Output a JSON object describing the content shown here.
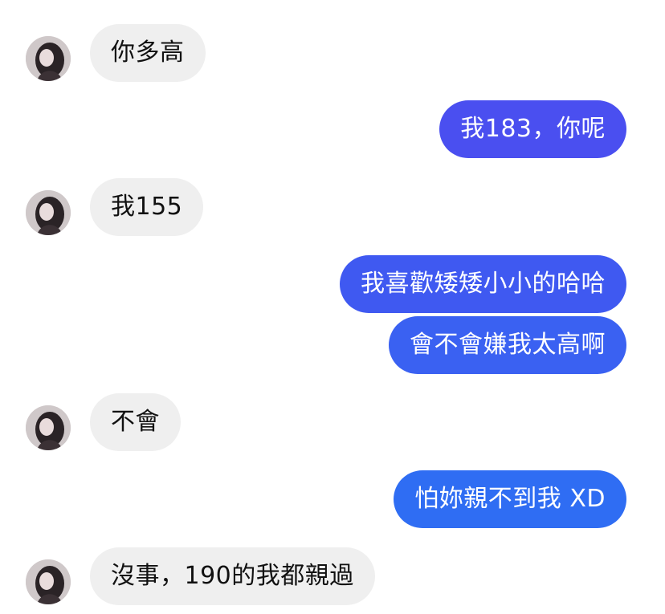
{
  "colors": {
    "incoming_bubble": "#efefef",
    "outgoing_bubble_top": "#4a4ff0",
    "outgoing_bubble_bottom": "#2f6df3",
    "incoming_text": "#111111",
    "outgoing_text": "#ffffff"
  },
  "contact": {
    "avatar_icon": "profile-photo-icon"
  },
  "messages": [
    {
      "side": "incoming",
      "text": "你多高"
    },
    {
      "side": "outgoing",
      "text": "我183，你呢"
    },
    {
      "side": "incoming",
      "text": "我155"
    },
    {
      "side": "outgoing",
      "text": "我喜歡矮矮小小的哈哈"
    },
    {
      "side": "outgoing",
      "text": "會不會嫌我太高啊"
    },
    {
      "side": "incoming",
      "text": "不會"
    },
    {
      "side": "outgoing",
      "text": "怕妳親不到我 XD"
    },
    {
      "side": "incoming",
      "text": "沒事，190的我都親過"
    }
  ]
}
